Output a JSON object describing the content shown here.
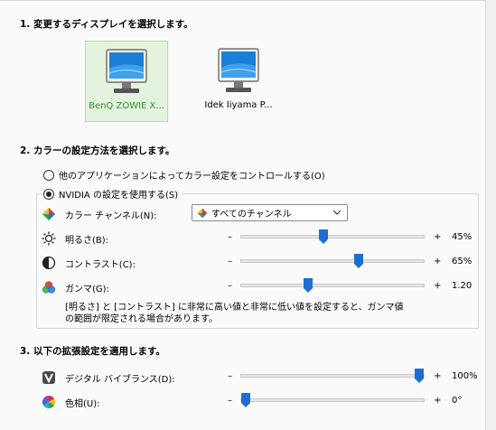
{
  "section1": {
    "heading": "1. 変更するディスプレイを選択します。"
  },
  "displays": [
    {
      "label": "BenQ ZOWIE X...",
      "selected": true
    },
    {
      "label": "Idek Iiyama P...",
      "selected": false
    }
  ],
  "section2": {
    "heading": "2. カラーの設定方法を選択します。",
    "radio_other_apps": "他のアプリケーションによってカラー設定をコントロールする(O)",
    "radio_nvidia": "NVIDIA の設定を使用する(S)"
  },
  "color_channel": {
    "label": "カラー チャンネル(N):",
    "selected": "すべてのチャンネル"
  },
  "brightness": {
    "label": "明るさ(B):",
    "minus": "–",
    "plus": "+",
    "value": "45%",
    "level": 0.45
  },
  "contrast": {
    "label": "コントラスト(C):",
    "minus": "–",
    "plus": "+",
    "value": "65%",
    "level": 0.65
  },
  "gamma": {
    "label": "ガンマ(G):",
    "minus": "–",
    "plus": "+",
    "value": "1.20",
    "level": 0.36
  },
  "note": "[明るさ] と [コントラスト] に非常に高い値と非常に低い値を設定すると、ガンマ値の範囲が限定される場合があります。",
  "section3": {
    "heading": "3. 以下の拡張設定を適用します。"
  },
  "digital_vibrance": {
    "label": "デジタル バイブランス(D):",
    "minus": "–",
    "plus": "+",
    "value": "100%",
    "level": 1.0
  },
  "hue": {
    "label": "色相(U):",
    "minus": "–",
    "plus": "+",
    "value": "0°",
    "level": 0.0
  },
  "colors": {
    "accent_blue": "#1c6fd1",
    "selected_green": "#2f8e2f"
  },
  "icons": {
    "monitor": "monitor-icon",
    "color_channel": "color-diamond-icon",
    "brightness": "sun-icon",
    "contrast": "contrast-icon",
    "gamma": "rgb-circles-icon",
    "digital_vibrance": "vibrance-icon",
    "hue": "color-wheel-icon"
  }
}
